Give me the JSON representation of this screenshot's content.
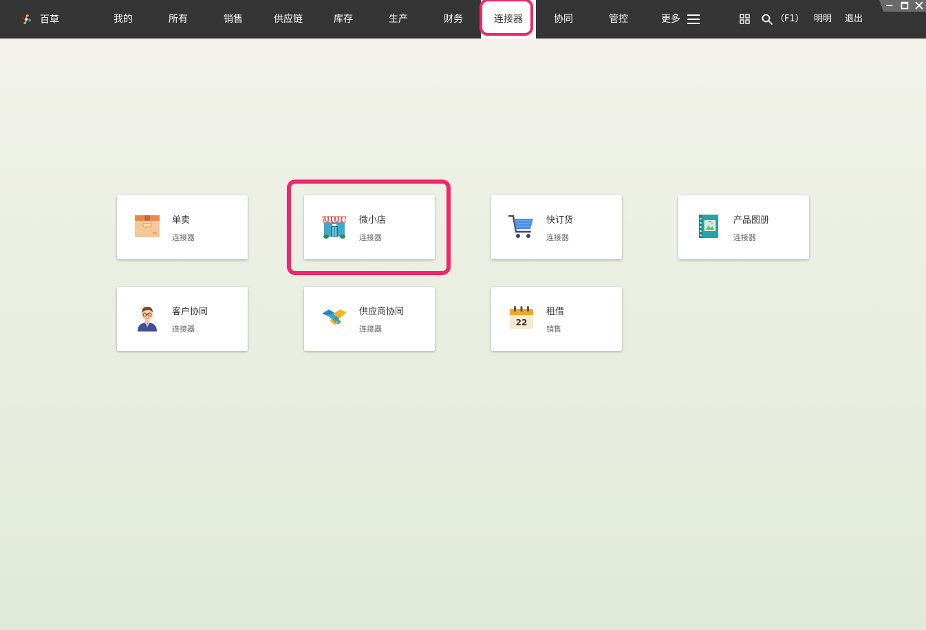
{
  "brand": {
    "name": "百草",
    "icon": "pinwheel-logo-icon"
  },
  "nav": {
    "items": [
      {
        "key": "mine",
        "label": "我的"
      },
      {
        "key": "all",
        "label": "所有"
      },
      {
        "key": "sales",
        "label": "销售"
      },
      {
        "key": "supply",
        "label": "供应链"
      },
      {
        "key": "inventory",
        "label": "库存"
      },
      {
        "key": "production",
        "label": "生产"
      },
      {
        "key": "finance",
        "label": "财务"
      },
      {
        "key": "connector",
        "label": "连接器",
        "active": true
      },
      {
        "key": "collab",
        "label": "协同"
      },
      {
        "key": "control",
        "label": "管控"
      },
      {
        "key": "more",
        "label": "更多"
      }
    ]
  },
  "toolbar": {
    "search_shortcut": "（F1）",
    "user": "明明",
    "logout": "退出"
  },
  "cards": [
    {
      "title": "单卖",
      "subtitle": "连接器",
      "icon": "box-icon"
    },
    {
      "title": "微小店",
      "subtitle": "连接器",
      "icon": "storefront-icon",
      "highlighted": true
    },
    {
      "title": "快订货",
      "subtitle": "连接器",
      "icon": "shopping-cart-icon"
    },
    {
      "title": "产品图册",
      "subtitle": "连接器",
      "icon": "photo-album-icon"
    },
    {
      "title": "客户协同",
      "subtitle": "连接器",
      "icon": "customer-avatar-icon"
    },
    {
      "title": "供应商协同",
      "subtitle": "连接器",
      "icon": "handshake-icon"
    },
    {
      "title": "租借",
      "subtitle": "销售",
      "icon": "calendar-icon",
      "icon_text": "22"
    }
  ],
  "colors": {
    "topbar": "#353535",
    "highlight": "#f3266b",
    "background_top": "#f3f3ec",
    "background_bottom": "#e1ead8"
  }
}
